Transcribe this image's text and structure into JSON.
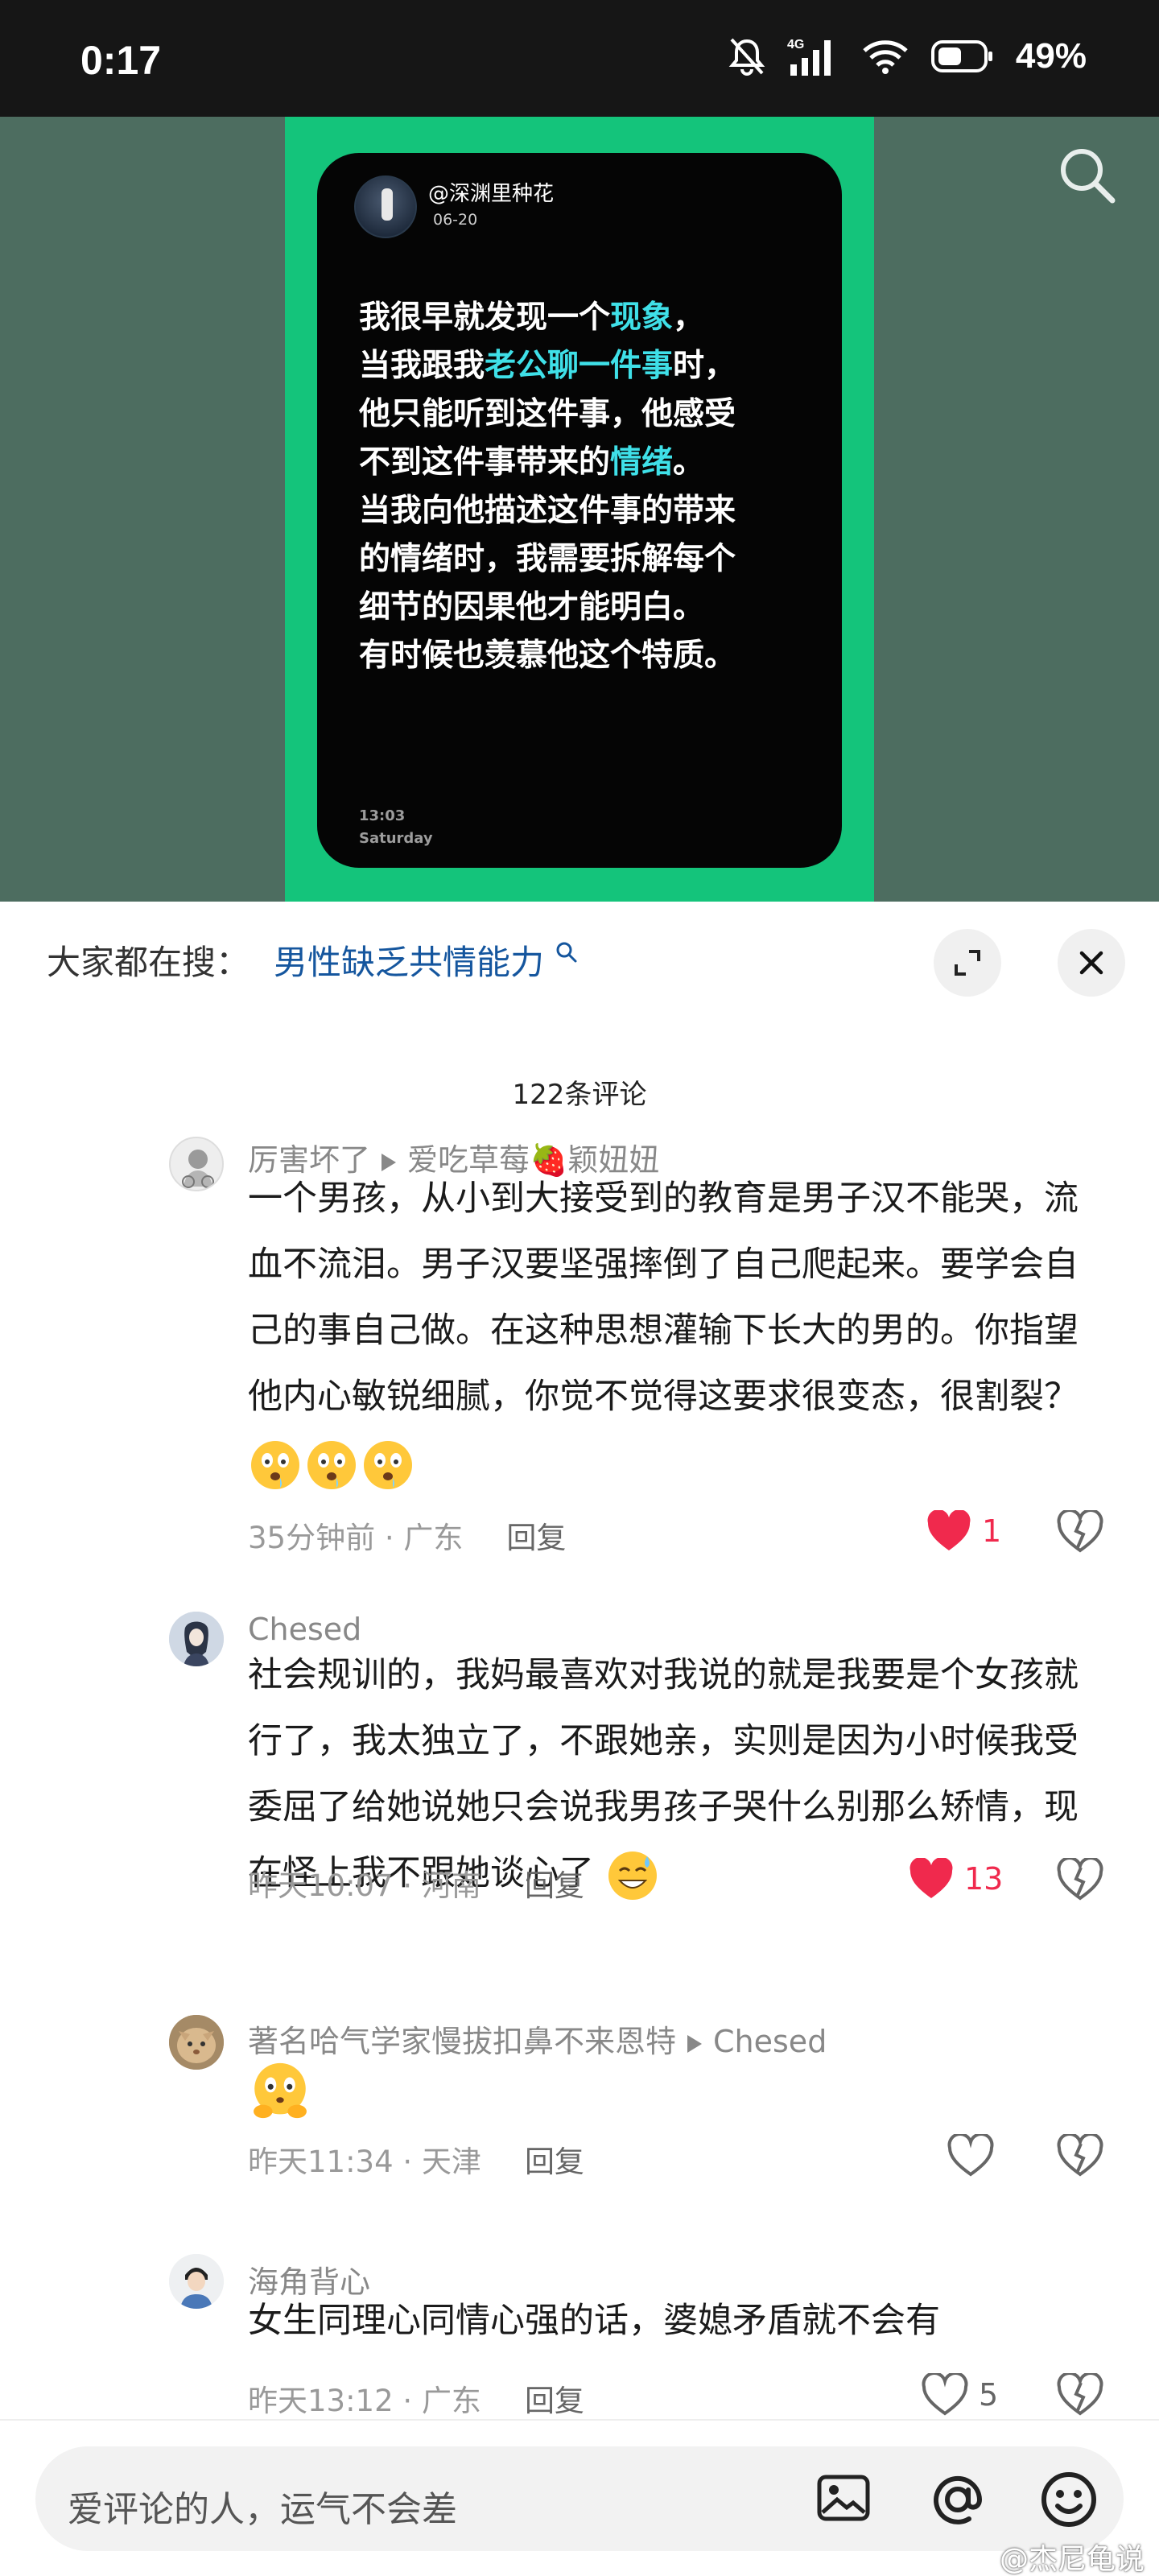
{
  "status_bar": {
    "time": "0:17",
    "network": "4G",
    "battery": "49%"
  },
  "media": {
    "handle": "@深渊里种花",
    "date": "06-20",
    "lines": [
      [
        {
          "t": "我很早就发现一个"
        },
        {
          "t": "现象",
          "h": true
        },
        {
          "t": "，"
        }
      ],
      [
        {
          "t": "当我跟我"
        },
        {
          "t": "老公聊一件事",
          "h": true
        },
        {
          "t": "时，"
        }
      ],
      [
        {
          "t": "他只能听到这件事，他感受"
        }
      ],
      [
        {
          "t": "不到这件事带来的"
        },
        {
          "t": "情绪",
          "h": true
        },
        {
          "t": "。"
        }
      ],
      [
        {
          "t": "当我向他描述这件事的带来"
        }
      ],
      [
        {
          "t": "的情绪时，我需要拆解每个"
        }
      ],
      [
        {
          "t": "细节的因果他才能明白。"
        }
      ],
      [
        {
          "t": "有时候也羡慕他这个特质。"
        }
      ]
    ],
    "clock_time": "13:03",
    "clock_day": "Saturday",
    "highlight_color": "#3fe0e8",
    "poster_color": "#14c47b"
  },
  "sheet": {
    "hot_search_label": "大家都在搜：",
    "hot_search_query": "男性缺乏共情能力",
    "comment_count": "122条评论"
  },
  "comments": [
    {
      "author": "厉害坏了",
      "reply_to": "爱吃草莓🍓颖妞妞",
      "body": "一个男孩，从小到大接受到的教育是男子汉不能哭，流血不流泪。男子汉要坚强摔倒了自己爬起来。要学会自己的事自己做。在这种思想灌输下长大的男的。你指望他内心敏锐细腻，你觉不觉得这要求很变态，很割裂？",
      "time": "35分钟前",
      "location": "广东",
      "reply_label": "回复",
      "likes": "1",
      "liked": true
    },
    {
      "author": "Chesed",
      "body": "社会规训的，我妈最喜欢对我说的就是我要是个女孩就行了，我太独立了，不跟她亲，实则是因为小时候我受委屈了给她说她只会说我男孩子哭什么别那么矫情，现在怪上我不跟她谈心了",
      "time": "昨天10:07",
      "location": "河南",
      "reply_label": "回复",
      "likes": "13",
      "liked": true
    },
    {
      "author": "著名哈气学家慢拔扣鼻不来恩特",
      "reply_to": "Chesed",
      "body": "",
      "time": "昨天11:34",
      "location": "天津",
      "reply_label": "回复",
      "likes": "",
      "liked": false
    },
    {
      "author": "海角背心",
      "body": "女生同理心同情心强的话，婆媳矛盾就不会有",
      "time": "昨天13:12",
      "location": "广东",
      "reply_label": "回复",
      "likes": "5",
      "liked": false
    }
  ],
  "input": {
    "placeholder": "爱评论的人，运气不会差"
  },
  "watermark": "@杰尼龟说",
  "colors": {
    "like_red": "#f0294d",
    "link_blue": "#15569e"
  }
}
